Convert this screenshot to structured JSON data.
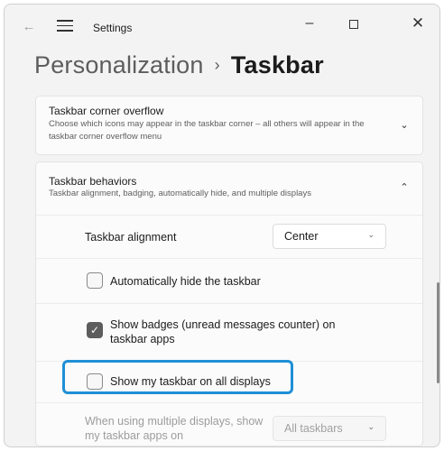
{
  "window": {
    "app_title": "Settings",
    "controls": {
      "minimize": "–",
      "close": "✕"
    }
  },
  "breadcrumb": {
    "parent": "Personalization",
    "separator": "›",
    "current": "Taskbar"
  },
  "overflow_card": {
    "title": "Taskbar corner overflow",
    "description": "Choose which icons may appear in the taskbar corner – all others will appear in the taskbar corner overflow menu",
    "chevron": "⌄",
    "expanded": false
  },
  "behaviors_card": {
    "title": "Taskbar behaviors",
    "description": "Taskbar alignment, badging, automatically hide, and multiple displays",
    "chevron": "⌃",
    "expanded": true,
    "alignment": {
      "label": "Taskbar alignment",
      "value": "Center",
      "arrow": "⌄"
    },
    "auto_hide": {
      "label": "Automatically hide the taskbar",
      "checked": false
    },
    "badges": {
      "label": "Show badges (unread messages counter) on taskbar apps",
      "checked": true,
      "check_glyph": "✓"
    },
    "all_displays": {
      "label": "Show my taskbar on all displays",
      "checked": false,
      "focused": true
    },
    "multi_display_apps": {
      "label": "When using multiple displays, show my taskbar apps on",
      "value": "All taskbars",
      "arrow": "⌄",
      "enabled": false
    }
  },
  "colors": {
    "focus_ring": "#1f8fd6",
    "checkbox_checked": "#5d5d5d"
  }
}
